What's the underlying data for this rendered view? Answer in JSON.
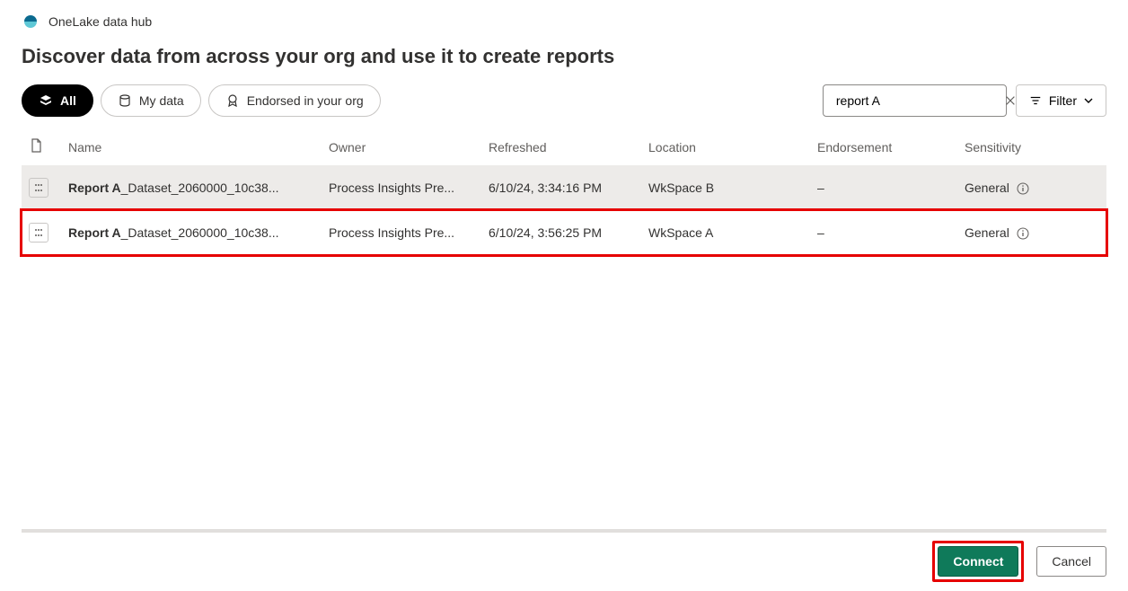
{
  "header": {
    "hub_title": "OneLake data hub",
    "page_heading": "Discover data from across your org and use it to create reports"
  },
  "toolbar": {
    "pills": {
      "all": "All",
      "my_data": "My data",
      "endorsed": "Endorsed in your org"
    },
    "search_value": "report A",
    "filter_label": "Filter"
  },
  "table": {
    "headers": {
      "name": "Name",
      "owner": "Owner",
      "refreshed": "Refreshed",
      "location": "Location",
      "endorsement": "Endorsement",
      "sensitivity": "Sensitivity"
    },
    "rows": [
      {
        "name_bold": "Report A",
        "name_rest": "_Dataset_2060000_10c38...",
        "owner": "Process Insights Pre...",
        "refreshed": "6/10/24, 3:34:16 PM",
        "location": "WkSpace B",
        "endorsement": "–",
        "sensitivity": "General"
      },
      {
        "name_bold": "Report A",
        "name_rest": "_Dataset_2060000_10c38...",
        "owner": "Process Insights Pre...",
        "refreshed": "6/10/24, 3:56:25 PM",
        "location": "WkSpace A",
        "endorsement": "–",
        "sensitivity": "General"
      }
    ]
  },
  "footer": {
    "connect": "Connect",
    "cancel": "Cancel"
  }
}
